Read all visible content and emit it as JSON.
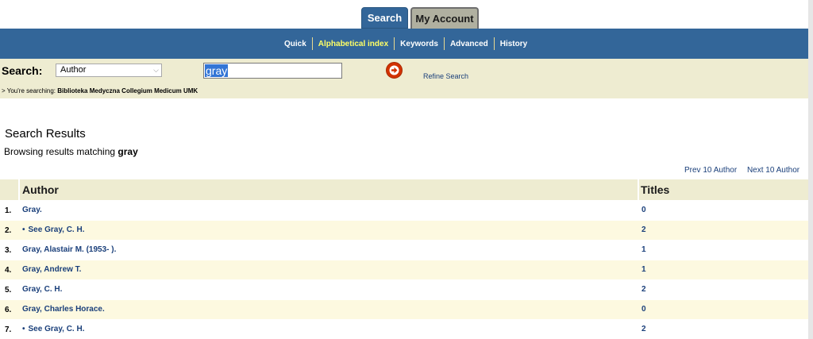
{
  "tabs": {
    "search": "Search",
    "account": "My Account"
  },
  "nav": {
    "items": [
      {
        "label": "Quick",
        "active": false
      },
      {
        "label": "Alphabetical index",
        "active": true
      },
      {
        "label": "Keywords",
        "active": false
      },
      {
        "label": "Advanced",
        "active": false
      },
      {
        "label": "History",
        "active": false
      }
    ]
  },
  "search": {
    "label": "Search:",
    "field_selected": "Author",
    "query": "gray",
    "refine_label": "Refine Search",
    "searching_prefix": "> You're searching:",
    "searching_library": "Biblioteka Medyczna Collegium Medicum UMK"
  },
  "results": {
    "title": "Search Results",
    "browsing_prefix": "Browsing results matching",
    "browsing_term": "gray",
    "prev_label": "Prev 10 Author",
    "next_label": "Next 10 Author",
    "columns": {
      "author": "Author",
      "titles": "Titles"
    },
    "rows": [
      {
        "num": "1.",
        "author": "Gray.",
        "see": false,
        "titles": "0"
      },
      {
        "num": "2.",
        "author": "See Gray, C. H.",
        "see": true,
        "titles": "2"
      },
      {
        "num": "3.",
        "author": "Gray, Alastair M. (1953- ).",
        "see": false,
        "titles": "1"
      },
      {
        "num": "4.",
        "author": "Gray, Andrew T.",
        "see": false,
        "titles": "1"
      },
      {
        "num": "5.",
        "author": "Gray, C. H.",
        "see": false,
        "titles": "2"
      },
      {
        "num": "6.",
        "author": "Gray, Charles Horace.",
        "see": false,
        "titles": "0"
      },
      {
        "num": "7.",
        "author": "See Gray, C. H.",
        "see": true,
        "titles": "2"
      }
    ]
  },
  "colors": {
    "nav_blue": "#336699",
    "panel_beige": "#eeecd1",
    "link_blue": "#1a3f7a",
    "active_nav": "#ffff66",
    "go_button": "#d23200"
  },
  "icons": {
    "go": "arrow-right-circle-icon",
    "bullet": "bullet-icon",
    "select": "chevron-down-icon"
  }
}
